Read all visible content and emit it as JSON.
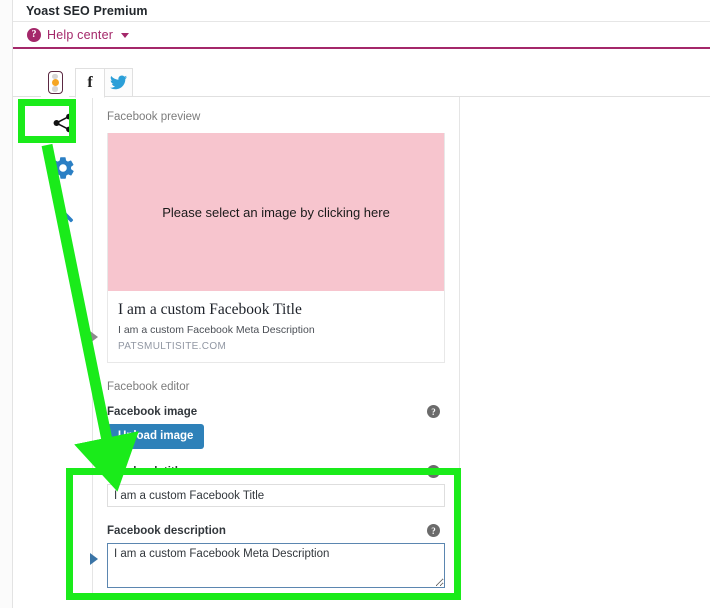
{
  "header": {
    "metabox_title": "Yoast SEO Premium",
    "help_center_label": "Help center",
    "help_icon_glyph": "?",
    "caret_icon": "chevron-down-icon"
  },
  "tabs": [
    {
      "id": "seo",
      "label": "SEO score traffic light",
      "icon": "traffic-light-icon",
      "active": false
    },
    {
      "id": "facebook",
      "label": "Facebook",
      "icon": "facebook-f-icon",
      "glyph": "f",
      "active": true
    },
    {
      "id": "twitter",
      "label": "Twitter",
      "icon": "twitter-bird-icon",
      "active": false
    }
  ],
  "rail": [
    {
      "id": "share",
      "icon": "share-icon",
      "highlighted": true
    },
    {
      "id": "settings",
      "icon": "gear-icon",
      "highlighted": false
    },
    {
      "id": "tools",
      "icon": "wrench-icon",
      "highlighted": false
    }
  ],
  "preview": {
    "section_label": "Facebook preview",
    "image_placeholder": "Please select an image by clicking here",
    "title": "I am a custom Facebook Title",
    "description": "I am a custom Facebook Meta Description",
    "url": "PATSMULTISITE.COM",
    "image_bg_color": "#f7c5ce"
  },
  "editor": {
    "section_label": "Facebook editor",
    "image_field": {
      "label": "Facebook image",
      "button_label": "Upload image",
      "help_glyph": "?"
    },
    "title_field": {
      "label": "Facebook title",
      "value": "I am a custom Facebook Title",
      "placeholder": "",
      "help_glyph": "?"
    },
    "description_field": {
      "label": "Facebook description",
      "value": "I am a custom Facebook Meta Description",
      "placeholder": "",
      "help_glyph": "?",
      "focused": true
    }
  },
  "annotations": {
    "highlight_color": "#1aeb1a",
    "share_tab_box": "share icon highlighted",
    "fields_box": "Facebook title and description fields highlighted",
    "arrow": "green arrow from share icon to Facebook fields"
  },
  "colors": {
    "brand_purple": "#a4286a",
    "button_blue": "#2e81b9",
    "focus_blue": "#5b86b0",
    "traffic_light_on": "#f5a623",
    "annotation_green": "#1aeb1a"
  }
}
